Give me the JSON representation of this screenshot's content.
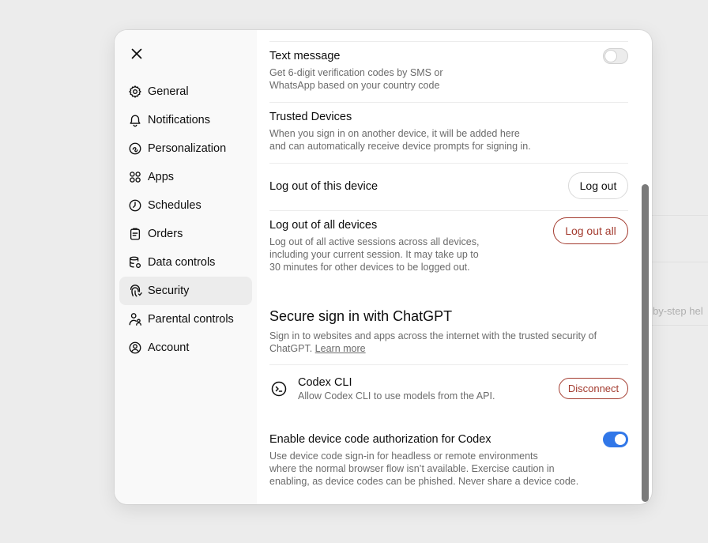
{
  "background": {
    "snippet": "by-step hel"
  },
  "nav": {
    "items": [
      {
        "label": "General"
      },
      {
        "label": "Notifications"
      },
      {
        "label": "Personalization"
      },
      {
        "label": "Apps"
      },
      {
        "label": "Schedules"
      },
      {
        "label": "Orders"
      },
      {
        "label": "Data controls"
      },
      {
        "label": "Security"
      },
      {
        "label": "Parental controls"
      },
      {
        "label": "Account"
      }
    ],
    "active": "Security"
  },
  "security": {
    "text_message": {
      "title": "Text message",
      "desc1": "Get 6-digit verification codes by SMS or",
      "desc2": "WhatsApp based on your country code",
      "enabled": false
    },
    "trusted_devices": {
      "title": "Trusted Devices",
      "desc1": "When you sign in on another device, it will be added here",
      "desc2": "and can automatically receive device prompts for signing in."
    },
    "logout_device": {
      "title": "Log out of this device",
      "button": "Log out"
    },
    "logout_all": {
      "title": "Log out of all devices",
      "desc1": "Log out of all active sessions across all devices,",
      "desc2": "including your current session. It may take up to",
      "desc3": "30 minutes for other devices to be logged out.",
      "button": "Log out all"
    },
    "secure_signin": {
      "title": "Secure sign in with ChatGPT",
      "desc1": "Sign in to websites and apps across the internet with the trusted security of",
      "desc2_prefix": "ChatGPT.",
      "link": "Learn more"
    },
    "codex_cli": {
      "title": "Codex CLI",
      "desc": "Allow Codex CLI to use models from the API.",
      "button": "Disconnect"
    },
    "device_code": {
      "title": "Enable device code authorization for Codex",
      "desc1": "Use device code sign-in for headless or remote environments",
      "desc2": "where the normal browser flow isn’t available. Exercise caution in",
      "desc3": "enabling, as device codes can be phished. Never share a device code.",
      "enabled": true
    }
  },
  "colors": {
    "accent": "#3177e8",
    "danger": "#a33b2f",
    "sidebar_bg": "#f9f9f9",
    "active_bg": "#ececec"
  }
}
